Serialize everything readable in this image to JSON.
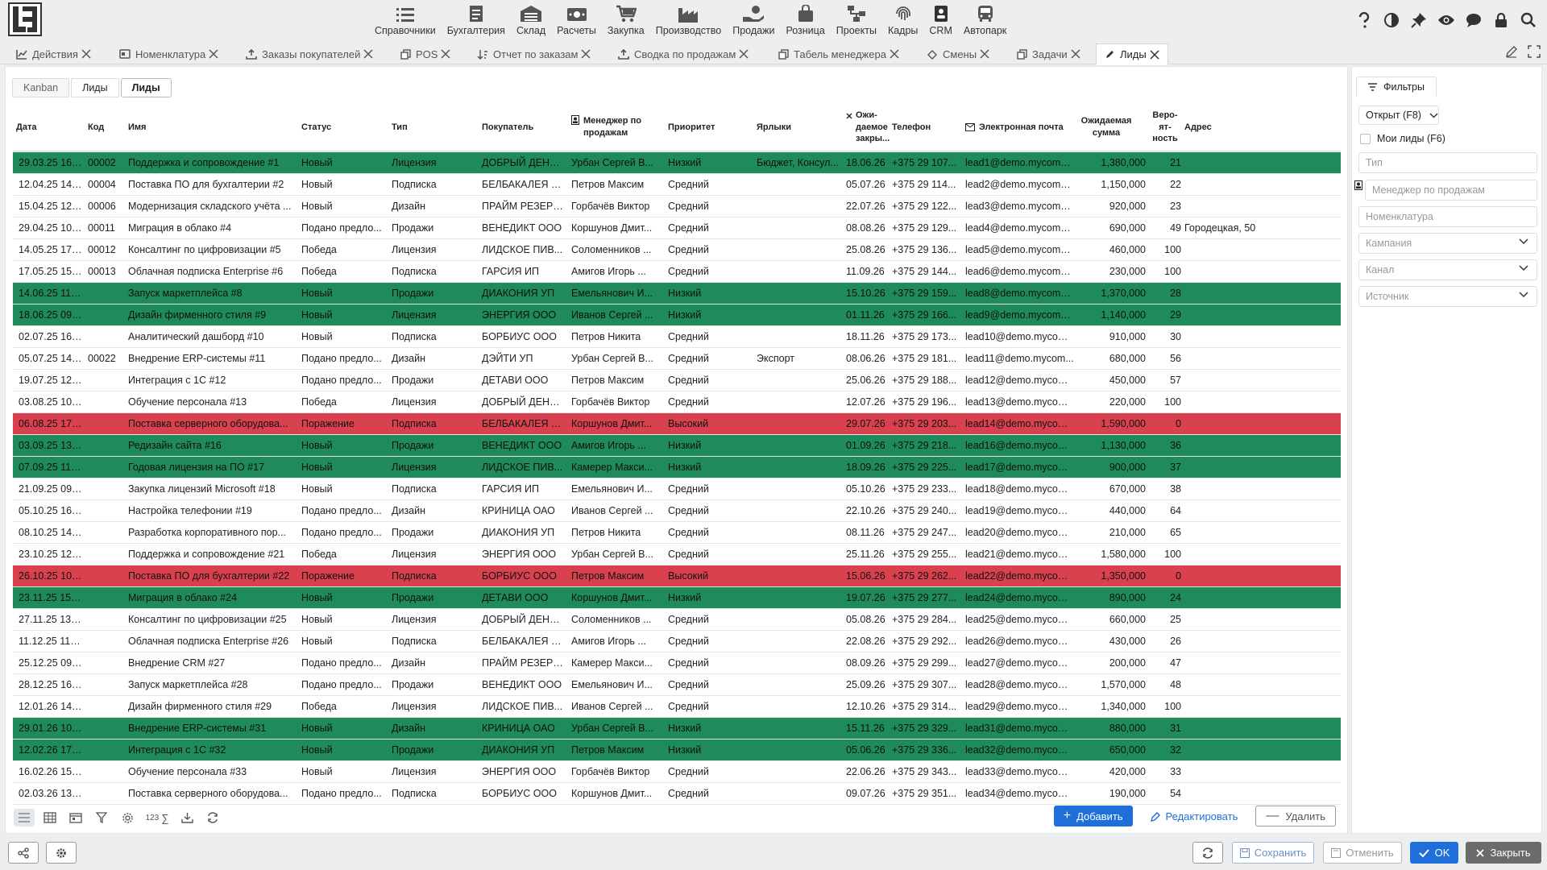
{
  "app": {
    "logo": "LB-logo"
  },
  "modules": [
    {
      "label": "Справочники",
      "icon": "list-icon"
    },
    {
      "label": "Бухгалтерия",
      "icon": "document-icon"
    },
    {
      "label": "Склад",
      "icon": "warehouse-icon"
    },
    {
      "label": "Расчеты",
      "icon": "money-icon"
    },
    {
      "label": "Закупка",
      "icon": "cart-icon"
    },
    {
      "label": "Производство",
      "icon": "factory-icon"
    },
    {
      "label": "Продажи",
      "icon": "sales-icon"
    },
    {
      "label": "Розница",
      "icon": "bag-icon"
    },
    {
      "label": "Проекты",
      "icon": "network-icon"
    },
    {
      "label": "Кадры",
      "icon": "fingerprint-icon"
    },
    {
      "label": "CRM",
      "icon": "crm-icon"
    },
    {
      "label": "Автопарк",
      "icon": "bus-icon"
    }
  ],
  "tabs": [
    {
      "label": "Действия",
      "icon": "chart-icon"
    },
    {
      "label": "Номенклатура",
      "icon": "card-icon"
    },
    {
      "label": "Заказы покупателей",
      "icon": "upload-icon"
    },
    {
      "label": "POS",
      "icon": "copy-icon"
    },
    {
      "label": "Отчет по заказам",
      "icon": "sort-icon"
    },
    {
      "label": "Сводка по продажам",
      "icon": "upload-icon"
    },
    {
      "label": "Табель менеджера",
      "icon": "copy-icon"
    },
    {
      "label": "Смены",
      "icon": "refresh-icon"
    },
    {
      "label": "Задачи",
      "icon": "copy-icon"
    },
    {
      "label": "Лиды",
      "icon": "pencil-icon",
      "active": true
    }
  ],
  "subtabs": [
    "Kanban",
    "Лиды",
    "Лиды"
  ],
  "columns": {
    "date": "Дата",
    "code": "Код",
    "name": "Имя",
    "status": "Статус",
    "type": "Тип",
    "buyer": "Покупатель",
    "manager": "Менеджер по продажам",
    "priority": "Приоритет",
    "labels": "Ярлыки",
    "close": "Ожи-даемое закры...",
    "phone": "Телефон",
    "email": "Электронная почта",
    "sum": "Ожидаемая сумма",
    "prob": "Веро-ят-ность",
    "addr": "Адрес"
  },
  "rows": [
    {
      "c": "g",
      "date": "29.03.25 16:17",
      "code": "00002",
      "name": "Поддержка и сопровождение #1",
      "status": "Новый",
      "type": "Лицензия",
      "buyer": "ДОБРЫЙ ДЕНЬ ...",
      "manager": "Урбан Сергей В...",
      "priority": "Низкий",
      "labels": "Бюджет, Консул...",
      "close": "18.06.26",
      "phone": "+375 29 107...",
      "email": "lead1@demo.mycomp...",
      "sum": "1,380,000",
      "prob": "21",
      "addr": ""
    },
    {
      "c": "",
      "date": "12.04.25 14:34",
      "code": "00004",
      "name": "Поставка ПО для бухгалтерии #2",
      "status": "Новый",
      "type": "Подписка",
      "buyer": "БЕЛБАКАЛЕЯ О...",
      "manager": "Петров Максим",
      "priority": "Средний",
      "labels": "",
      "close": "05.07.26",
      "phone": "+375 29 114...",
      "email": "lead2@demo.mycomp...",
      "sum": "1,150,000",
      "prob": "22",
      "addr": ""
    },
    {
      "c": "",
      "date": "15.04.25 12:51",
      "code": "00006",
      "name": "Модернизация складского учёта ...",
      "status": "Новый",
      "type": "Дизайн",
      "buyer": "ПРАЙМ РЕЗЕРВ ...",
      "manager": "Горбачёв Виктор",
      "priority": "Средний",
      "labels": "",
      "close": "22.07.26",
      "phone": "+375 29 122...",
      "email": "lead3@demo.mycomp...",
      "sum": "920,000",
      "prob": "23",
      "addr": ""
    },
    {
      "c": "",
      "date": "29.04.25 10:08",
      "code": "00011",
      "name": "Миграция в облако #4",
      "status": "Подано предло...",
      "type": "Продажи",
      "buyer": "ВЕНЕДИКТ ООО",
      "manager": "Коршунов Дмит...",
      "priority": "Средний",
      "labels": "",
      "close": "08.08.26",
      "phone": "+375 29 129...",
      "email": "lead4@demo.mycomp...",
      "sum": "690,000",
      "prob": "49",
      "addr": "Городецкая, 50"
    },
    {
      "c": "",
      "date": "14.05.25 17:25",
      "code": "00012",
      "name": "Консалтинг по цифровизации #5",
      "status": "Победа",
      "type": "Лицензия",
      "buyer": "ЛИДСКОЕ ПИВ...",
      "manager": "Соломенников ...",
      "priority": "Средний",
      "labels": "",
      "close": "25.08.26",
      "phone": "+375 29 136...",
      "email": "lead5@demo.mycomp...",
      "sum": "460,000",
      "prob": "100",
      "addr": ""
    },
    {
      "c": "",
      "date": "17.05.25 15:42",
      "code": "00013",
      "name": "Облачная подписка Enterprise #6",
      "status": "Победа",
      "type": "Подписка",
      "buyer": "ГАРСИЯ ИП",
      "manager": "Амигов Игорь ...",
      "priority": "Средний",
      "labels": "",
      "close": "11.09.26",
      "phone": "+375 29 144...",
      "email": "lead6@demo.mycomp...",
      "sum": "230,000",
      "prob": "100",
      "addr": ""
    },
    {
      "c": "g",
      "date": "14.06.25 11:16",
      "code": "",
      "name": "Запуск маркетплейса #8",
      "status": "Новый",
      "type": "Продажи",
      "buyer": "ДИАКОНИЯ УП",
      "manager": "Емельянович И...",
      "priority": "Низкий",
      "labels": "",
      "close": "15.10.26",
      "phone": "+375 29 159...",
      "email": "lead8@demo.mycomp...",
      "sum": "1,370,000",
      "prob": "28",
      "addr": ""
    },
    {
      "c": "g",
      "date": "18.06.25 09:33",
      "code": "",
      "name": "Дизайн фирменного стиля #9",
      "status": "Новый",
      "type": "Лицензия",
      "buyer": "ЭНЕРГИЯ ООО",
      "manager": "Иванов Сергей ...",
      "priority": "Низкий",
      "labels": "",
      "close": "01.11.26",
      "phone": "+375 29 166...",
      "email": "lead9@demo.mycomp...",
      "sum": "1,140,000",
      "prob": "29",
      "addr": ""
    },
    {
      "c": "",
      "date": "02.07.25 16:59",
      "code": "",
      "name": "Аналитический дашборд #10",
      "status": "Новый",
      "type": "Подписка",
      "buyer": "БОРБИУС ООО",
      "manager": "Петров Никита",
      "priority": "Средний",
      "labels": "",
      "close": "18.11.26",
      "phone": "+375 29 173...",
      "email": "lead10@demo.mycom...",
      "sum": "910,000",
      "prob": "30",
      "addr": ""
    },
    {
      "c": "",
      "date": "05.07.25 14:07",
      "code": "00022",
      "name": "Внедрение ERP-системы #11",
      "status": "Подано предло...",
      "type": "Дизайн",
      "buyer": "ДЭЙТИ УП",
      "manager": "Урбан Сергей В...",
      "priority": "Средний",
      "labels": "Экспорт",
      "close": "08.06.26",
      "phone": "+375 29 181...",
      "email": "lead11@demo.mycom...",
      "sum": "680,000",
      "prob": "56",
      "addr": ""
    },
    {
      "c": "",
      "date": "19.07.25 12:24",
      "code": "",
      "name": "Интеграция с 1С #12",
      "status": "Подано предло...",
      "type": "Продажи",
      "buyer": "ДЕТАВИ ООО",
      "manager": "Петров Максим",
      "priority": "Средний",
      "labels": "",
      "close": "25.06.26",
      "phone": "+375 29 188...",
      "email": "lead12@demo.mycom...",
      "sum": "450,000",
      "prob": "57",
      "addr": ""
    },
    {
      "c": "",
      "date": "03.08.25 10:41",
      "code": "",
      "name": "Обучение персонала #13",
      "status": "Победа",
      "type": "Лицензия",
      "buyer": "ДОБРЫЙ ДЕНЬ ...",
      "manager": "Горбачёв Виктор",
      "priority": "Средний",
      "labels": "",
      "close": "12.07.26",
      "phone": "+375 29 196...",
      "email": "lead13@demo.mycom...",
      "sum": "220,000",
      "prob": "100",
      "addr": ""
    },
    {
      "c": "r",
      "date": "06.08.25 17:58",
      "code": "",
      "name": "Поставка серверного оборудова...",
      "status": "Поражение",
      "type": "Подписка",
      "buyer": "БЕЛБАКАЛЕЯ О...",
      "manager": "Коршунов Дмит...",
      "priority": "Высокий",
      "labels": "",
      "close": "29.07.26",
      "phone": "+375 29 203...",
      "email": "lead14@demo.mycom...",
      "sum": "1,590,000",
      "prob": "0",
      "addr": ""
    },
    {
      "c": "g",
      "date": "03.09.25 13:32",
      "code": "",
      "name": "Редизайн сайта #16",
      "status": "Новый",
      "type": "Продажи",
      "buyer": "ВЕНЕДИКТ ООО",
      "manager": "Амигов Игорь ...",
      "priority": "Низкий",
      "labels": "",
      "close": "01.09.26",
      "phone": "+375 29 218...",
      "email": "lead16@demo.mycom...",
      "sum": "1,130,000",
      "prob": "36",
      "addr": ""
    },
    {
      "c": "g",
      "date": "07.09.25 11:49",
      "code": "",
      "name": "Годовая лицензия на ПО #17",
      "status": "Новый",
      "type": "Лицензия",
      "buyer": "ЛИДСКОЕ ПИВ...",
      "manager": "Камерер Макси...",
      "priority": "Низкий",
      "labels": "",
      "close": "18.09.26",
      "phone": "+375 29 225...",
      "email": "lead17@demo.mycom...",
      "sum": "900,000",
      "prob": "37",
      "addr": ""
    },
    {
      "c": "",
      "date": "21.09.25 09:06",
      "code": "",
      "name": "Закупка лицензий Microsoft #18",
      "status": "Новый",
      "type": "Подписка",
      "buyer": "ГАРСИЯ ИП",
      "manager": "Емельянович И...",
      "priority": "Средний",
      "labels": "",
      "close": "05.10.26",
      "phone": "+375 29 233...",
      "email": "lead18@demo.mycom...",
      "sum": "670,000",
      "prob": "38",
      "addr": ""
    },
    {
      "c": "",
      "date": "05.10.25 16:23",
      "code": "",
      "name": "Настройка телефонии #19",
      "status": "Подано предло...",
      "type": "Дизайн",
      "buyer": "КРИНИЦА ОАО",
      "manager": "Иванов Сергей ...",
      "priority": "Средний",
      "labels": "",
      "close": "22.10.26",
      "phone": "+375 29 240...",
      "email": "lead19@demo.mycom...",
      "sum": "440,000",
      "prob": "64",
      "addr": ""
    },
    {
      "c": "",
      "date": "08.10.25 14:40",
      "code": "",
      "name": "Разработка корпоративного пор...",
      "status": "Подано предло...",
      "type": "Продажи",
      "buyer": "ДИАКОНИЯ УП",
      "manager": "Петров Никита",
      "priority": "Средний",
      "labels": "",
      "close": "08.11.26",
      "phone": "+375 29 247...",
      "email": "lead20@demo.mycom...",
      "sum": "210,000",
      "prob": "65",
      "addr": ""
    },
    {
      "c": "",
      "date": "23.10.25 12:57",
      "code": "",
      "name": "Поддержка и сопровождение #21",
      "status": "Победа",
      "type": "Лицензия",
      "buyer": "ЭНЕРГИЯ ООО",
      "manager": "Урбан Сергей В...",
      "priority": "Средний",
      "labels": "",
      "close": "25.11.26",
      "phone": "+375 29 255...",
      "email": "lead21@demo.mycom...",
      "sum": "1,580,000",
      "prob": "100",
      "addr": ""
    },
    {
      "c": "r",
      "date": "26.10.25 10:14",
      "code": "",
      "name": "Поставка ПО для бухгалтерии #22",
      "status": "Поражение",
      "type": "Подписка",
      "buyer": "БОРБИУС ООО",
      "manager": "Петров Максим",
      "priority": "Высокий",
      "labels": "",
      "close": "15.06.26",
      "phone": "+375 29 262...",
      "email": "lead22@demo.mycom...",
      "sum": "1,350,000",
      "prob": "0",
      "addr": ""
    },
    {
      "c": "g",
      "date": "23.11.25 15:48",
      "code": "",
      "name": "Миграция в облако #24",
      "status": "Новый",
      "type": "Продажи",
      "buyer": "ДЕТАВИ ООО",
      "manager": "Коршунов Дмит...",
      "priority": "Низкий",
      "labels": "",
      "close": "19.07.26",
      "phone": "+375 29 277...",
      "email": "lead24@demo.mycom...",
      "sum": "890,000",
      "prob": "24",
      "addr": ""
    },
    {
      "c": "",
      "date": "27.11.25 13:05",
      "code": "",
      "name": "Консалтинг по цифровизации #25",
      "status": "Новый",
      "type": "Лицензия",
      "buyer": "ДОБРЫЙ ДЕНЬ ...",
      "manager": "Соломенников ...",
      "priority": "Средний",
      "labels": "",
      "close": "05.08.26",
      "phone": "+375 29 284...",
      "email": "lead25@demo.mycom...",
      "sum": "660,000",
      "prob": "25",
      "addr": ""
    },
    {
      "c": "",
      "date": "11.12.25 11:22",
      "code": "",
      "name": "Облачная подписка Enterprise #26",
      "status": "Новый",
      "type": "Подписка",
      "buyer": "БЕЛБАКАЛЕЯ О...",
      "manager": "Амигов Игорь ...",
      "priority": "Средний",
      "labels": "",
      "close": "22.08.26",
      "phone": "+375 29 292...",
      "email": "lead26@demo.mycom...",
      "sum": "430,000",
      "prob": "26",
      "addr": ""
    },
    {
      "c": "",
      "date": "25.12.25 09:39",
      "code": "",
      "name": "Внедрение CRM #27",
      "status": "Подано предло...",
      "type": "Дизайн",
      "buyer": "ПРАЙМ РЕЗЕРВ ...",
      "manager": "Камерер Макси...",
      "priority": "Средний",
      "labels": "",
      "close": "08.09.26",
      "phone": "+375 29 299...",
      "email": "lead27@demo.mycom...",
      "sum": "200,000",
      "prob": "47",
      "addr": ""
    },
    {
      "c": "",
      "date": "28.12.25 16:56",
      "code": "",
      "name": "Запуск маркетплейса #28",
      "status": "Подано предло...",
      "type": "Продажи",
      "buyer": "ВЕНЕДИКТ ООО",
      "manager": "Емельянович И...",
      "priority": "Средний",
      "labels": "",
      "close": "25.09.26",
      "phone": "+375 29 307...",
      "email": "lead28@demo.mycom...",
      "sum": "1,570,000",
      "prob": "48",
      "addr": ""
    },
    {
      "c": "",
      "date": "12.01.26 14:13",
      "code": "",
      "name": "Дизайн фирменного стиля #29",
      "status": "Победа",
      "type": "Лицензия",
      "buyer": "ЛИДСКОЕ ПИВ...",
      "manager": "Иванов Сергей ...",
      "priority": "Средний",
      "labels": "",
      "close": "12.10.26",
      "phone": "+375 29 314...",
      "email": "lead29@demo.mycom...",
      "sum": "1,340,000",
      "prob": "100",
      "addr": ""
    },
    {
      "c": "g",
      "date": "29.01.26 10:47",
      "code": "",
      "name": "Внедрение ERP-системы #31",
      "status": "Новый",
      "type": "Дизайн",
      "buyer": "КРИНИЦА ОАО",
      "manager": "Урбан Сергей В...",
      "priority": "Низкий",
      "labels": "",
      "close": "15.11.26",
      "phone": "+375 29 329...",
      "email": "lead31@demo.mycom...",
      "sum": "880,000",
      "prob": "31",
      "addr": ""
    },
    {
      "c": "g",
      "date": "12.02.26 17:04",
      "code": "",
      "name": "Интеграция с 1С #32",
      "status": "Новый",
      "type": "Продажи",
      "buyer": "ДИАКОНИЯ УП",
      "manager": "Петров Максим",
      "priority": "Низкий",
      "labels": "",
      "close": "05.06.26",
      "phone": "+375 29 336...",
      "email": "lead32@demo.mycom...",
      "sum": "650,000",
      "prob": "32",
      "addr": ""
    },
    {
      "c": "",
      "date": "16.02.26 15:21",
      "code": "",
      "name": "Обучение персонала #33",
      "status": "Новый",
      "type": "Лицензия",
      "buyer": "ЭНЕРГИЯ ООО",
      "manager": "Горбачёв Виктор",
      "priority": "Средний",
      "labels": "",
      "close": "22.06.26",
      "phone": "+375 29 343...",
      "email": "lead33@demo.mycom...",
      "sum": "420,000",
      "prob": "33",
      "addr": ""
    },
    {
      "c": "",
      "date": "02.03.26 13:38",
      "code": "",
      "name": "Поставка серверного оборудова...",
      "status": "Подано предло...",
      "type": "Подписка",
      "buyer": "БОРБИУС ООО",
      "manager": "Коршунов Дмит...",
      "priority": "Средний",
      "labels": "",
      "close": "09.07.26",
      "phone": "+375 29 351...",
      "email": "lead34@demo.mycom...",
      "sum": "190,000",
      "prob": "54",
      "addr": ""
    }
  ],
  "toolbar": {
    "counter": "123",
    "sigma": "∑",
    "add": "Добавить",
    "edit": "Редактировать",
    "delete": "Удалить"
  },
  "filters": {
    "title": "Фильтры",
    "status": "Открыт (F8)",
    "my_leads": "Мои лиды (F6)",
    "type": "Тип",
    "manager": "Менеджер по продажам",
    "nomenclature": "Номенклатура",
    "campaign": "Кампания",
    "channel": "Канал",
    "source": "Источник"
  },
  "footer": {
    "save": "Сохранить",
    "cancel": "Отменить",
    "ok": "OK",
    "close": "Закрыть"
  },
  "colors": {
    "green": "#1f8a5a",
    "red": "#d9414f",
    "accent": "#1e6fd9"
  }
}
